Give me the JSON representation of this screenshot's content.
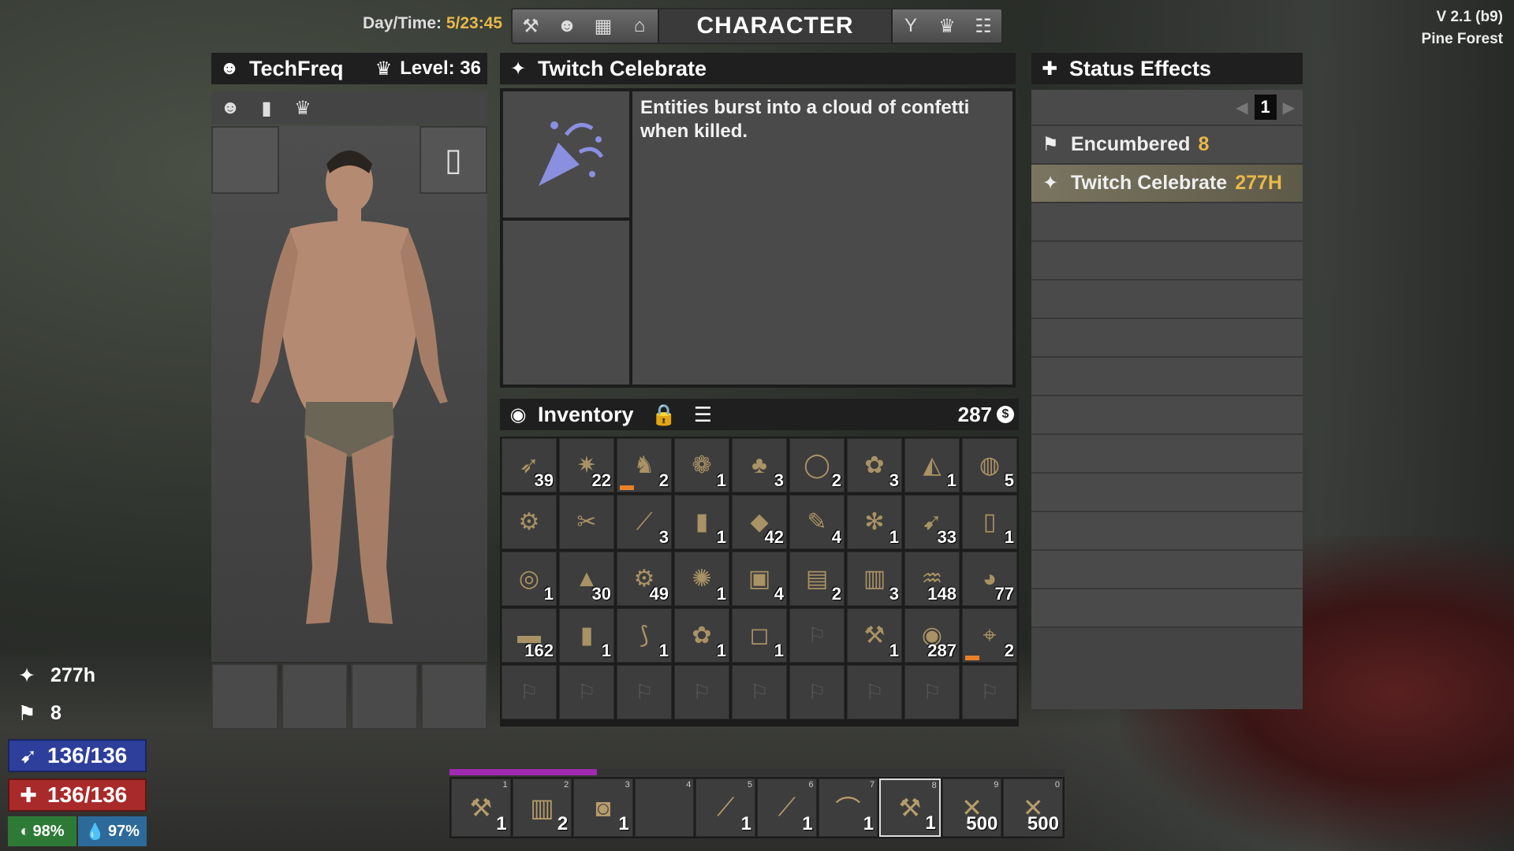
{
  "top": {
    "daytime_label": "Day/Time:",
    "daytime_value": "5/23:45",
    "nav_title": "CHARACTER",
    "nav_left_icons": [
      "hammer-icon",
      "person-icon",
      "map-icon",
      "graduation-cap-icon"
    ],
    "nav_right_icons": [
      "goblet-icon",
      "trophy-icon",
      "group-icon"
    ],
    "version": "V 2.1 (b9)",
    "biome": "Pine Forest"
  },
  "character": {
    "name": "TechFreq",
    "level_label": "Level: 36",
    "tabs": [
      "person-icon",
      "stats-bars-icon",
      "trophy-icon"
    ]
  },
  "buff": {
    "title": "Twitch Celebrate",
    "description": "Entities burst into a cloud of confetti when killed."
  },
  "inventory": {
    "title": "Inventory",
    "coins": "287",
    "rows": [
      [
        {
          "q": "39"
        },
        {
          "q": "22"
        },
        {
          "q": "2",
          "d": true
        },
        {
          "q": "1"
        },
        {
          "q": "3"
        },
        {
          "q": "2"
        },
        {
          "q": "3"
        },
        {
          "q": "1"
        },
        {
          "q": "5"
        }
      ],
      [
        {
          "q": ""
        },
        {
          "q": ""
        },
        {
          "q": "3"
        },
        {
          "q": "1"
        },
        {
          "q": "42"
        },
        {
          "q": "4"
        },
        {
          "q": "1"
        },
        {
          "q": "33"
        },
        {
          "q": "1"
        }
      ],
      [
        {
          "q": "1"
        },
        {
          "q": "30"
        },
        {
          "q": "49"
        },
        {
          "q": "1"
        },
        {
          "q": "4"
        },
        {
          "q": "2"
        },
        {
          "q": "3"
        },
        {
          "q": "148"
        },
        {
          "q": "77"
        }
      ],
      [
        {
          "q": "162"
        },
        {
          "q": "1"
        },
        {
          "q": "1"
        },
        {
          "q": "1"
        },
        {
          "q": "1"
        },
        {
          "q": "",
          "e": true
        },
        {
          "q": "1"
        },
        {
          "q": "287"
        },
        {
          "q": "2",
          "d": true
        }
      ],
      [
        {
          "q": "",
          "e": true
        },
        {
          "q": "",
          "e": true
        },
        {
          "q": "",
          "e": true
        },
        {
          "q": "",
          "e": true
        },
        {
          "q": "",
          "e": true
        },
        {
          "q": "",
          "e": true
        },
        {
          "q": "",
          "e": true
        },
        {
          "q": "",
          "e": true
        },
        {
          "q": "",
          "e": true
        }
      ]
    ]
  },
  "status": {
    "title": "Status Effects",
    "page": "1",
    "effects": [
      {
        "name": "Encumbered",
        "value": "8",
        "active": false
      },
      {
        "name": "Twitch Celebrate",
        "value": "277H",
        "active": true
      }
    ]
  },
  "hud": {
    "buff_time": "277h",
    "encumbered": "8",
    "stamina": "136/136",
    "health": "136/136",
    "food": "98%",
    "water": "97%"
  },
  "toolbelt": {
    "xp_fraction": 0.24,
    "slots": [
      {
        "num": "1",
        "qty": "1"
      },
      {
        "num": "2",
        "qty": "2"
      },
      {
        "num": "3",
        "qty": "1"
      },
      {
        "num": "4",
        "qty": ""
      },
      {
        "num": "5",
        "qty": "1"
      },
      {
        "num": "6",
        "qty": "1"
      },
      {
        "num": "7",
        "qty": "1"
      },
      {
        "num": "8",
        "qty": "1",
        "selected": true
      },
      {
        "num": "9",
        "qty": "500"
      },
      {
        "num": "0",
        "qty": "500"
      }
    ]
  },
  "colors": {
    "accent_gold": "#e8b84a",
    "stamina_blue": "#2d3f9a",
    "health_red": "#a92a2a",
    "xp_purple": "#a02ab0"
  }
}
